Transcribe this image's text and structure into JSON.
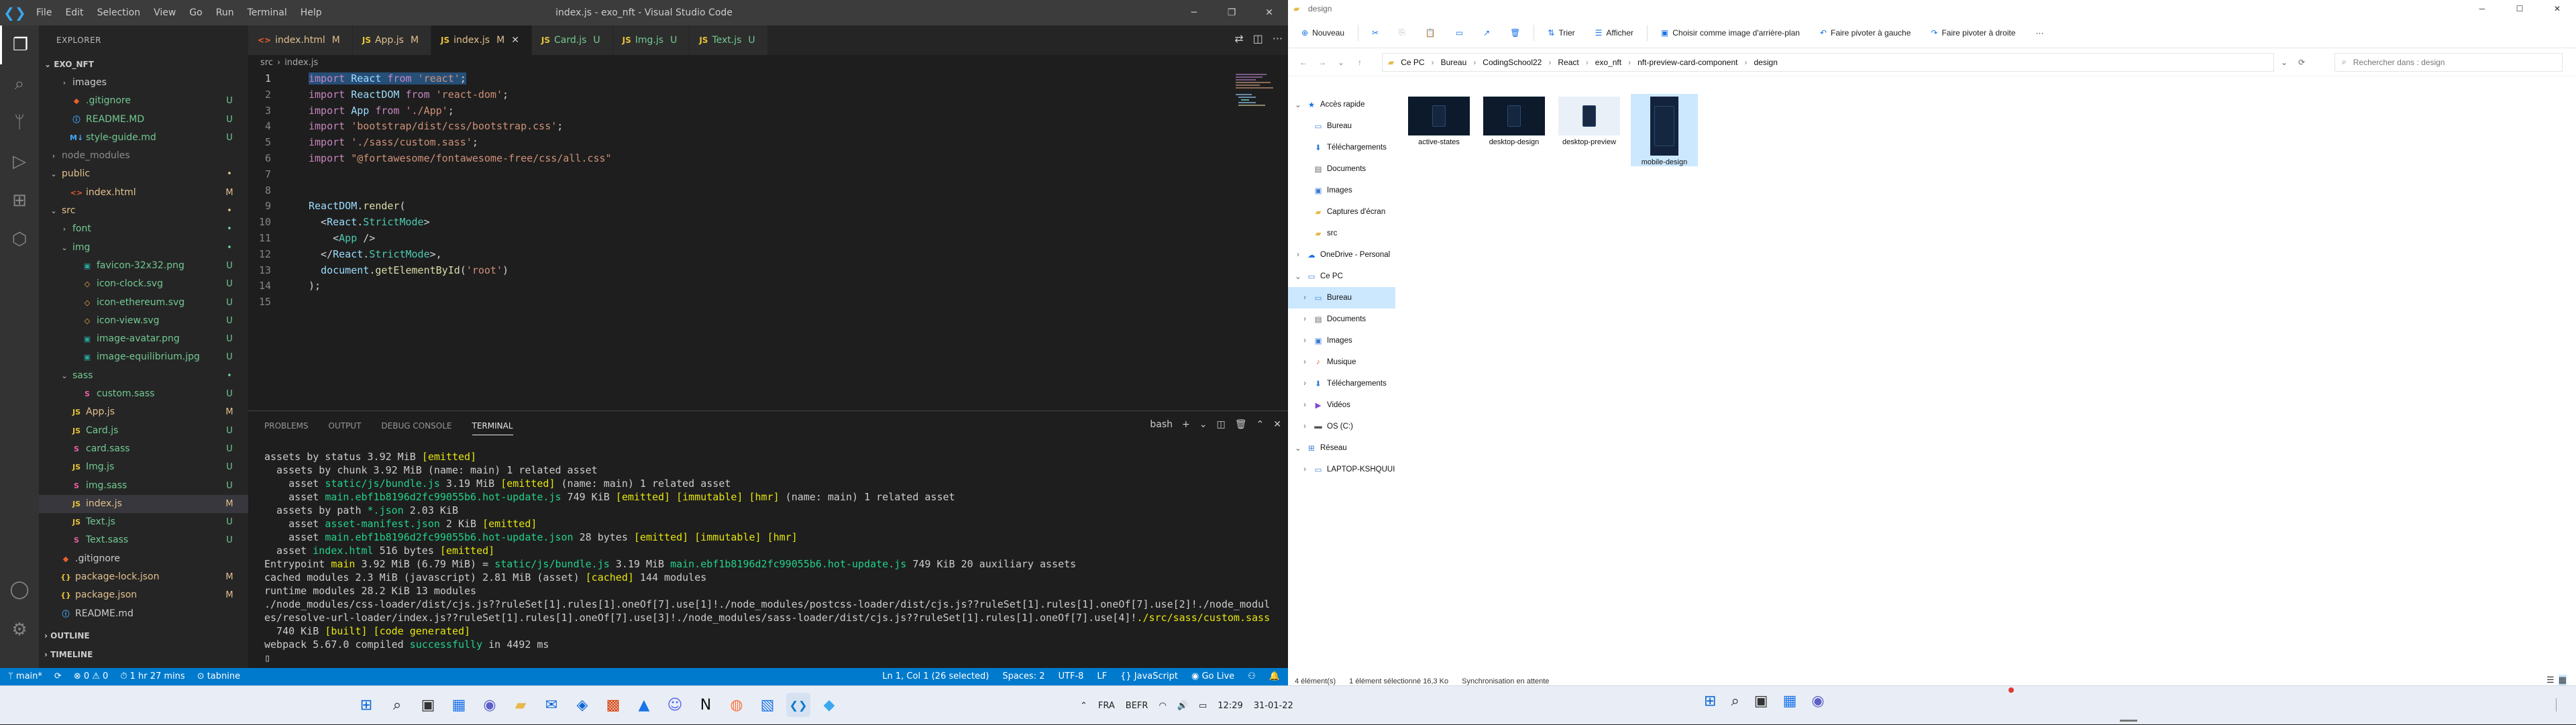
{
  "vscode": {
    "title": "index.js - exo_nft - Visual Studio Code",
    "menu": [
      "File",
      "Edit",
      "Selection",
      "View",
      "Go",
      "Run",
      "Terminal",
      "Help"
    ],
    "window_controls": [
      "─",
      "❐",
      "✕"
    ],
    "explorer_title": "EXPLORER",
    "project": "EXO_NFT",
    "tree": [
      {
        "name": "images",
        "type": "folder",
        "level": 1,
        "chev": "›",
        "status": "",
        "color": "#ccc"
      },
      {
        "name": ".gitignore",
        "type": "git",
        "level": 1,
        "status": "U",
        "color": "#73c991"
      },
      {
        "name": "README.MD",
        "type": "info",
        "level": 1,
        "status": "U",
        "color": "#73c991"
      },
      {
        "name": "style-guide.md",
        "type": "md",
        "level": 1,
        "status": "U",
        "color": "#73c991"
      },
      {
        "name": "node_modules",
        "type": "folder",
        "level": 0,
        "chev": "›",
        "status": "",
        "color": "#8c8c8c"
      },
      {
        "name": "public",
        "type": "folder",
        "level": 0,
        "chev": "⌄",
        "status": "•",
        "color": "#e2c08d"
      },
      {
        "name": "index.html",
        "type": "html",
        "level": 1,
        "status": "M",
        "color": "#e2c08d"
      },
      {
        "name": "src",
        "type": "folder",
        "level": 0,
        "chev": "⌄",
        "status": "•",
        "color": "#e2c08d"
      },
      {
        "name": "font",
        "type": "folder",
        "level": 1,
        "chev": "›",
        "status": "•",
        "color": "#73c991"
      },
      {
        "name": "img",
        "type": "folder",
        "level": 1,
        "chev": "⌄",
        "status": "•",
        "color": "#73c991"
      },
      {
        "name": "favicon-32x32.png",
        "type": "img",
        "level": 2,
        "status": "U",
        "color": "#73c991"
      },
      {
        "name": "icon-clock.svg",
        "type": "svg",
        "level": 2,
        "status": "U",
        "color": "#73c991"
      },
      {
        "name": "icon-ethereum.svg",
        "type": "svg",
        "level": 2,
        "status": "U",
        "color": "#73c991"
      },
      {
        "name": "icon-view.svg",
        "type": "svg",
        "level": 2,
        "status": "U",
        "color": "#73c991"
      },
      {
        "name": "image-avatar.png",
        "type": "img",
        "level": 2,
        "status": "U",
        "color": "#73c991"
      },
      {
        "name": "image-equilibrium.jpg",
        "type": "img",
        "level": 2,
        "status": "U",
        "color": "#73c991"
      },
      {
        "name": "sass",
        "type": "folder",
        "level": 1,
        "chev": "⌄",
        "status": "•",
        "color": "#73c991"
      },
      {
        "name": "custom.sass",
        "type": "sass",
        "level": 2,
        "status": "U",
        "color": "#73c991"
      },
      {
        "name": "App.js",
        "type": "js",
        "level": 1,
        "status": "M",
        "color": "#e2c08d"
      },
      {
        "name": "Card.js",
        "type": "js",
        "level": 1,
        "status": "U",
        "color": "#73c991"
      },
      {
        "name": "card.sass",
        "type": "sass",
        "level": 1,
        "status": "U",
        "color": "#73c991"
      },
      {
        "name": "Img.js",
        "type": "js",
        "level": 1,
        "status": "U",
        "color": "#73c991"
      },
      {
        "name": "img.sass",
        "type": "sass",
        "level": 1,
        "status": "U",
        "color": "#73c991"
      },
      {
        "name": "index.js",
        "type": "js",
        "level": 1,
        "status": "M",
        "color": "#e2c08d",
        "selected": true
      },
      {
        "name": "Text.js",
        "type": "js",
        "level": 1,
        "status": "U",
        "color": "#73c991"
      },
      {
        "name": "Text.sass",
        "type": "sass",
        "level": 1,
        "status": "U",
        "color": "#73c991"
      },
      {
        "name": ".gitignore",
        "type": "git",
        "level": 0,
        "status": "",
        "color": "#ccc"
      },
      {
        "name": "package-lock.json",
        "type": "json",
        "level": 0,
        "status": "M",
        "color": "#e2c08d"
      },
      {
        "name": "package.json",
        "type": "json",
        "level": 0,
        "status": "M",
        "color": "#e2c08d"
      },
      {
        "name": "README.md",
        "type": "info",
        "level": 0,
        "status": "",
        "color": "#ccc"
      }
    ],
    "outline": "OUTLINE",
    "timeline": "TIMELINE",
    "tabs": [
      {
        "name": "index.html",
        "status": "M",
        "icon": "<>",
        "color": "#e2c08d",
        "active": false
      },
      {
        "name": "App.js",
        "status": "M",
        "icon": "JS",
        "color": "#e2c08d",
        "active": false
      },
      {
        "name": "index.js",
        "status": "M",
        "icon": "JS",
        "color": "#e2c08d",
        "active": true
      },
      {
        "name": "Card.js",
        "status": "U",
        "icon": "JS",
        "color": "#73c991",
        "active": false
      },
      {
        "name": "Img.js",
        "status": "U",
        "icon": "JS",
        "color": "#73c991",
        "active": false
      },
      {
        "name": "Text.js",
        "status": "U",
        "icon": "JS",
        "color": "#73c991",
        "active": false
      }
    ],
    "breadcrumb": [
      "src",
      "›",
      "index.js"
    ],
    "code": [
      [
        [
          "k",
          "import"
        ],
        [
          "p",
          " "
        ],
        [
          "v",
          "React"
        ],
        [
          "p",
          " "
        ],
        [
          "k",
          "from"
        ],
        [
          "p",
          " "
        ],
        [
          "s",
          "'react'"
        ],
        [
          "p",
          ";"
        ]
      ],
      [
        [
          "k",
          "import"
        ],
        [
          "p",
          " "
        ],
        [
          "v",
          "ReactDOM"
        ],
        [
          "p",
          " "
        ],
        [
          "k",
          "from"
        ],
        [
          "p",
          " "
        ],
        [
          "s",
          "'react-dom'"
        ],
        [
          "p",
          ";"
        ]
      ],
      [
        [
          "k",
          "import"
        ],
        [
          "p",
          " "
        ],
        [
          "v",
          "App"
        ],
        [
          "p",
          " "
        ],
        [
          "k",
          "from"
        ],
        [
          "p",
          " "
        ],
        [
          "s",
          "'./App'"
        ],
        [
          "p",
          ";"
        ]
      ],
      [
        [
          "k",
          "import"
        ],
        [
          "p",
          " "
        ],
        [
          "s",
          "'bootstrap/dist/css/bootstrap.css'"
        ],
        [
          "p",
          ";"
        ]
      ],
      [
        [
          "k",
          "import"
        ],
        [
          "p",
          " "
        ],
        [
          "s",
          "'./sass/custom.sass'"
        ],
        [
          "p",
          ";"
        ]
      ],
      [
        [
          "k",
          "import"
        ],
        [
          "p",
          " "
        ],
        [
          "s",
          "\"@fortawesome/fontawesome-free/css/all.css\""
        ]
      ],
      [],
      [],
      [
        [
          "v",
          "ReactDOM"
        ],
        [
          "p",
          "."
        ],
        [
          "f",
          "render"
        ],
        [
          "p",
          "("
        ]
      ],
      [
        [
          "p",
          "  <"
        ],
        [
          "v",
          "React"
        ],
        [
          "p",
          "."
        ],
        [
          "t",
          "StrictMode"
        ],
        [
          "p",
          ">"
        ]
      ],
      [
        [
          "p",
          "    <"
        ],
        [
          "t",
          "App"
        ],
        [
          "p",
          " />"
        ]
      ],
      [
        [
          "p",
          "  </"
        ],
        [
          "v",
          "React"
        ],
        [
          "p",
          "."
        ],
        [
          "t",
          "StrictMode"
        ],
        [
          "p",
          ">,"
        ]
      ],
      [
        [
          "p",
          "  "
        ],
        [
          "v",
          "document"
        ],
        [
          "p",
          "."
        ],
        [
          "f",
          "getElementById"
        ],
        [
          "p",
          "("
        ],
        [
          "s",
          "'root'"
        ],
        [
          "p",
          ")"
        ]
      ],
      [
        [
          "p",
          ");"
        ]
      ],
      []
    ],
    "panel_tabs": [
      "PROBLEMS",
      "OUTPUT",
      "DEBUG CONSOLE",
      "TERMINAL"
    ],
    "panel_controls": [
      "bash",
      "+",
      "⌄",
      "◫",
      "🗑",
      "⌃",
      "✕"
    ],
    "terminal": [
      [
        [
          "",
          "assets by status 3.92 MiB "
        ],
        [
          "ty",
          "[emitted]"
        ]
      ],
      [
        [
          "",
          "  assets by chunk 3.92 MiB (name: main) 1 related asset"
        ]
      ],
      [
        [
          "",
          "    asset "
        ],
        [
          "tg2",
          "static/js/bundle.js"
        ],
        [
          "",
          " 3.19 MiB "
        ],
        [
          "ty",
          "[emitted]"
        ],
        [
          "",
          " (name: main) 1 related asset"
        ]
      ],
      [
        [
          "",
          "    asset "
        ],
        [
          "tg2",
          "main.ebf1b8196d2fc99055b6.hot-update.js"
        ],
        [
          "",
          " 749 KiB "
        ],
        [
          "ty",
          "[emitted] [immutable] [hmr]"
        ],
        [
          "",
          " (name: main) 1 related asset"
        ]
      ],
      [
        [
          "",
          "  assets by path "
        ],
        [
          "tg2",
          "*.json"
        ],
        [
          "",
          " 2.03 KiB"
        ]
      ],
      [
        [
          "",
          "    asset "
        ],
        [
          "tg2",
          "asset-manifest.json"
        ],
        [
          "",
          " 2 KiB "
        ],
        [
          "ty",
          "[emitted]"
        ]
      ],
      [
        [
          "",
          "    asset "
        ],
        [
          "tg2",
          "main.ebf1b8196d2fc99055b6.hot-update.json"
        ],
        [
          "",
          " 28 bytes "
        ],
        [
          "ty",
          "[emitted] [immutable] [hmr]"
        ]
      ],
      [
        [
          "",
          "  asset "
        ],
        [
          "tg2",
          "index.html"
        ],
        [
          "",
          " 516 bytes "
        ],
        [
          "ty",
          "[emitted]"
        ]
      ],
      [
        [
          "",
          "Entrypoint "
        ],
        [
          "ty",
          "main"
        ],
        [
          "",
          " 3.92 MiB (6.79 MiB) = "
        ],
        [
          "tg2",
          "static/js/bundle.js"
        ],
        [
          "",
          " 3.19 MiB "
        ],
        [
          "tg2",
          "main.ebf1b8196d2fc99055b6.hot-update.js"
        ],
        [
          "",
          " 749 KiB 20 auxiliary assets"
        ]
      ],
      [
        [
          "",
          "cached modules 2.3 MiB (javascript) 2.81 MiB (asset) "
        ],
        [
          "ty",
          "[cached]"
        ],
        [
          "",
          " 144 modules"
        ]
      ],
      [
        [
          "",
          "runtime modules 28.2 KiB 13 modules"
        ]
      ],
      [
        [
          "",
          "./node_modules/css-loader/dist/cjs.js??ruleSet[1].rules[1].oneOf[7].use[1]!./node_modules/postcss-loader/dist/cjs.js??ruleSet[1].rules[1].oneOf[7].use[2]!./node_modul"
        ]
      ],
      [
        [
          "",
          "es/resolve-url-loader/index.js??ruleSet[1].rules[1].oneOf[7].use[3]!./node_modules/sass-loader/dist/cjs.js??ruleSet[1].rules[1].oneOf[7].use[4]!"
        ],
        [
          "ty",
          "./src/sass/custom.sass"
        ]
      ],
      [
        [
          "",
          "  740 KiB "
        ],
        [
          "ty",
          "[built] [code generated]"
        ]
      ],
      [
        [
          "",
          "webpack 5.67.0 compiled "
        ],
        [
          "tg2",
          "successfully"
        ],
        [
          "",
          " in 4492 ms"
        ]
      ],
      [
        [
          "",
          "▯"
        ]
      ]
    ],
    "status_left": [
      "ᛘ main*",
      "⟳",
      "⊗ 0 ⚠ 0",
      "⏱ 1 hr 27 mins",
      "⊙ tabnine"
    ],
    "status_right": [
      "Ln 1, Col 1 (26 selected)",
      "Spaces: 2",
      "UTF-8",
      "LF",
      "{} JavaScript",
      "◉ Go Live",
      "⚇",
      "🔔"
    ]
  },
  "file_explorer": {
    "title": "design",
    "window_controls": [
      "─",
      "☐",
      "✕"
    ],
    "ribbon": [
      {
        "label": "Nouveau",
        "icon": "⊕",
        "dim": false
      },
      {
        "label": "",
        "icon": "✂",
        "dim": false
      },
      {
        "label": "",
        "icon": "⎘",
        "dim": true
      },
      {
        "label": "",
        "icon": "📋",
        "dim": true
      },
      {
        "label": "",
        "icon": "▭",
        "dim": false
      },
      {
        "label": "",
        "icon": "↗",
        "dim": false
      },
      {
        "label": "",
        "icon": "🗑",
        "dim": false
      },
      {
        "label": "Trier",
        "icon": "⇅",
        "dim": false
      },
      {
        "label": "Afficher",
        "icon": "☰",
        "dim": false
      },
      {
        "label": "Choisir comme image d'arrière-plan",
        "icon": "▣",
        "dim": false
      },
      {
        "label": "Faire pivoter à gauche",
        "icon": "↶",
        "dim": false
      },
      {
        "label": "Faire pivoter à droite",
        "icon": "↷",
        "dim": false
      },
      {
        "label": "···",
        "icon": "",
        "dim": false
      }
    ],
    "nav_arrows": [
      "←",
      "→",
      "⌄",
      "↑"
    ],
    "path": [
      "Ce PC",
      "›",
      "Bureau",
      "›",
      "CodingSchool22",
      "›",
      "React",
      "›",
      "exo_nft",
      "›",
      "nft-preview-card-component",
      "›",
      "design"
    ],
    "search_placeholder": "Rechercher dans : design",
    "nav": [
      {
        "label": "Accès rapide",
        "icon": "★",
        "indent": 0,
        "chev": "⌄",
        "color": "#1a73e8"
      },
      {
        "label": "Bureau",
        "icon": "▭",
        "indent": 1,
        "chev": "",
        "color": "#3a7bd5"
      },
      {
        "label": "Téléchargements",
        "icon": "⬇",
        "indent": 1,
        "chev": "",
        "color": "#2b7bd5"
      },
      {
        "label": "Documents",
        "icon": "▤",
        "indent": 1,
        "chev": "",
        "color": "#666"
      },
      {
        "label": "Images",
        "icon": "▣",
        "indent": 1,
        "chev": "",
        "color": "#3a7bd5"
      },
      {
        "label": "Captures d'écran",
        "icon": "▰",
        "indent": 1,
        "chev": "",
        "color": "#e8b84a"
      },
      {
        "label": "src",
        "icon": "▰",
        "indent": 1,
        "chev": "",
        "color": "#e8b84a"
      },
      {
        "label": "OneDrive - Personal",
        "icon": "☁",
        "indent": 0,
        "chev": "›",
        "color": "#1a73e8"
      },
      {
        "label": "Ce PC",
        "icon": "▭",
        "indent": 0,
        "chev": "⌄",
        "color": "#3a7bd5"
      },
      {
        "label": "Bureau",
        "icon": "▭",
        "indent": 1,
        "chev": "›",
        "color": "#3a7bd5",
        "selected": true
      },
      {
        "label": "Documents",
        "icon": "▤",
        "indent": 1,
        "chev": "›",
        "color": "#666"
      },
      {
        "label": "Images",
        "icon": "▣",
        "indent": 1,
        "chev": "›",
        "color": "#3a7bd5"
      },
      {
        "label": "Musique",
        "icon": "♪",
        "indent": 1,
        "chev": "›",
        "color": "#e85a3a"
      },
      {
        "label": "Téléchargements",
        "icon": "⬇",
        "indent": 1,
        "chev": "›",
        "color": "#2b7bd5"
      },
      {
        "label": "Vidéos",
        "icon": "▶",
        "indent": 1,
        "chev": "›",
        "color": "#7a4bd5"
      },
      {
        "label": "OS (C:)",
        "icon": "▬",
        "indent": 1,
        "chev": "›",
        "color": "#555"
      },
      {
        "label": "Réseau",
        "icon": "⊞",
        "indent": 0,
        "chev": "⌄",
        "color": "#3a7bd5"
      },
      {
        "label": "LAPTOP-KSHQUUI",
        "icon": "▭",
        "indent": 1,
        "chev": "›",
        "color": "#3a7bd5"
      }
    ],
    "files": [
      {
        "name": "active-states",
        "selected": false
      },
      {
        "name": "desktop-design",
        "selected": false
      },
      {
        "name": "desktop-preview",
        "selected": false
      },
      {
        "name": "mobile-design",
        "selected": true
      }
    ],
    "status": [
      "4 élément(s)",
      "1 élément sélectionné  16,3 Ko",
      "Synchronisation en attente"
    ]
  },
  "taskbar": {
    "left_icons": [
      {
        "name": "windows-start-icon",
        "glyph": "⊞",
        "color": "#0a64d8"
      },
      {
        "name": "search-icon",
        "glyph": "⌕",
        "color": "#222"
      },
      {
        "name": "task-view-icon",
        "glyph": "▣",
        "color": "#333"
      },
      {
        "name": "widgets-icon",
        "glyph": "▦",
        "color": "#1a73e8"
      },
      {
        "name": "teams-chat-icon",
        "glyph": "◉",
        "color": "#5b5fc7"
      },
      {
        "name": "file-explorer-icon",
        "glyph": "▰",
        "color": "#e8b84a"
      },
      {
        "name": "mail-icon",
        "glyph": "✉",
        "color": "#0a64d8"
      },
      {
        "name": "store-icon",
        "glyph": "◈",
        "color": "#0a64d8"
      },
      {
        "name": "office-icon",
        "glyph": "▩",
        "color": "#d83b01"
      },
      {
        "name": "photos-icon",
        "glyph": "▲",
        "color": "#1a73e8"
      },
      {
        "name": "discord-icon",
        "glyph": "☺",
        "color": "#5865f2"
      },
      {
        "name": "notion-icon",
        "glyph": "N",
        "color": "#111"
      },
      {
        "name": "firefox-icon",
        "glyph": "◍",
        "color": "#ff7139"
      },
      {
        "name": "photo-viewer-icon",
        "glyph": "▧",
        "color": "#1a73e8"
      },
      {
        "name": "vscode-icon",
        "glyph": "❮❯",
        "color": "#0a7acc"
      },
      {
        "name": "tabnine-icon",
        "glyph": "◆",
        "color": "#3aa7f0"
      }
    ],
    "tray": [
      "⌃",
      "FRA",
      "BEFR",
      "12:29",
      "31-01-22"
    ]
  }
}
